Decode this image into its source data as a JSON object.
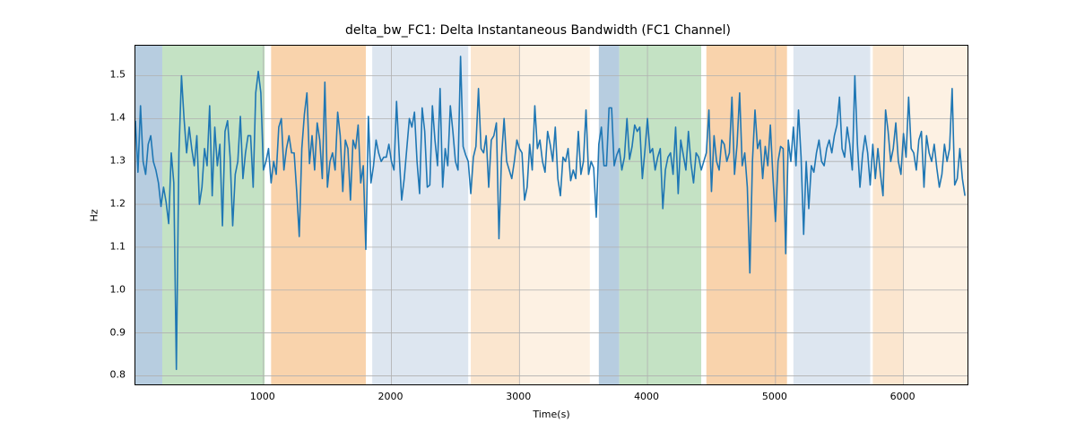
{
  "chart_data": {
    "type": "line",
    "title": "delta_bw_FC1: Delta Instantaneous Bandwidth (FC1 Channel)",
    "xlabel": "Time(s)",
    "ylabel": "Hz",
    "xlim": [
      0,
      6500
    ],
    "ylim": [
      0.78,
      1.57
    ],
    "xticks": [
      1000,
      2000,
      3000,
      4000,
      5000,
      6000
    ],
    "yticks": [
      0.8,
      0.9,
      1.0,
      1.1,
      1.2,
      1.3,
      1.4,
      1.5
    ],
    "bands": [
      {
        "x0": 0,
        "x1": 210,
        "color": "#b7cde0"
      },
      {
        "x0": 210,
        "x1": 1010,
        "color": "#c4e2c4"
      },
      {
        "x0": 1060,
        "x1": 1800,
        "color": "#f9d3ac"
      },
      {
        "x0": 1850,
        "x1": 2600,
        "color": "#dde6f0"
      },
      {
        "x0": 2620,
        "x1": 3000,
        "color": "#fbe6cf"
      },
      {
        "x0": 3000,
        "x1": 3550,
        "color": "#fdf1e3"
      },
      {
        "x0": 3620,
        "x1": 3780,
        "color": "#b7cde0"
      },
      {
        "x0": 3780,
        "x1": 4420,
        "color": "#c4e2c4"
      },
      {
        "x0": 4460,
        "x1": 5090,
        "color": "#f9d3ac"
      },
      {
        "x0": 5140,
        "x1": 5740,
        "color": "#dde6f0"
      },
      {
        "x0": 5760,
        "x1": 6000,
        "color": "#fbe6cf"
      },
      {
        "x0": 6000,
        "x1": 6500,
        "color": "#fdf1e3"
      }
    ],
    "series": [
      {
        "name": "delta_bw_FC1",
        "color": "#1f77b4",
        "x_step": 20,
        "values": [
          1.395,
          1.275,
          1.43,
          1.3,
          1.27,
          1.34,
          1.36,
          1.3,
          1.28,
          1.25,
          1.195,
          1.24,
          1.205,
          1.155,
          1.32,
          1.25,
          0.815,
          1.32,
          1.5,
          1.4,
          1.32,
          1.38,
          1.33,
          1.29,
          1.36,
          1.2,
          1.24,
          1.33,
          1.29,
          1.43,
          1.22,
          1.38,
          1.29,
          1.34,
          1.15,
          1.37,
          1.395,
          1.31,
          1.15,
          1.27,
          1.3,
          1.405,
          1.26,
          1.32,
          1.36,
          1.36,
          1.24,
          1.46,
          1.51,
          1.46,
          1.28,
          1.3,
          1.33,
          1.25,
          1.3,
          1.27,
          1.38,
          1.4,
          1.28,
          1.33,
          1.36,
          1.32,
          1.32,
          1.23,
          1.125,
          1.33,
          1.41,
          1.46,
          1.295,
          1.36,
          1.28,
          1.39,
          1.35,
          1.26,
          1.485,
          1.24,
          1.3,
          1.32,
          1.28,
          1.415,
          1.36,
          1.23,
          1.35,
          1.33,
          1.21,
          1.35,
          1.33,
          1.385,
          1.25,
          1.29,
          1.095,
          1.405,
          1.25,
          1.29,
          1.35,
          1.32,
          1.3,
          1.31,
          1.31,
          1.34,
          1.3,
          1.28,
          1.44,
          1.32,
          1.21,
          1.26,
          1.33,
          1.4,
          1.38,
          1.415,
          1.3,
          1.225,
          1.425,
          1.37,
          1.24,
          1.245,
          1.43,
          1.35,
          1.29,
          1.47,
          1.24,
          1.33,
          1.29,
          1.43,
          1.37,
          1.3,
          1.28,
          1.545,
          1.335,
          1.315,
          1.3,
          1.225,
          1.31,
          1.335,
          1.47,
          1.33,
          1.32,
          1.36,
          1.24,
          1.35,
          1.36,
          1.39,
          1.12,
          1.31,
          1.4,
          1.3,
          1.28,
          1.26,
          1.3,
          1.35,
          1.33,
          1.32,
          1.21,
          1.24,
          1.34,
          1.28,
          1.43,
          1.33,
          1.35,
          1.3,
          1.275,
          1.37,
          1.34,
          1.3,
          1.38,
          1.26,
          1.22,
          1.31,
          1.3,
          1.33,
          1.255,
          1.28,
          1.26,
          1.37,
          1.27,
          1.3,
          1.42,
          1.27,
          1.3,
          1.285,
          1.17,
          1.34,
          1.38,
          1.29,
          1.29,
          1.425,
          1.425,
          1.29,
          1.315,
          1.33,
          1.28,
          1.31,
          1.4,
          1.305,
          1.335,
          1.385,
          1.37,
          1.38,
          1.26,
          1.325,
          1.4,
          1.32,
          1.33,
          1.28,
          1.31,
          1.33,
          1.19,
          1.28,
          1.31,
          1.32,
          1.27,
          1.38,
          1.225,
          1.35,
          1.315,
          1.28,
          1.37,
          1.295,
          1.25,
          1.32,
          1.31,
          1.28,
          1.3,
          1.32,
          1.42,
          1.23,
          1.36,
          1.3,
          1.28,
          1.35,
          1.34,
          1.3,
          1.32,
          1.45,
          1.27,
          1.34,
          1.46,
          1.29,
          1.32,
          1.24,
          1.04,
          1.3,
          1.42,
          1.33,
          1.35,
          1.26,
          1.335,
          1.29,
          1.385,
          1.265,
          1.16,
          1.3,
          1.335,
          1.33,
          1.085,
          1.35,
          1.3,
          1.38,
          1.29,
          1.42,
          1.31,
          1.13,
          1.3,
          1.19,
          1.29,
          1.275,
          1.32,
          1.35,
          1.3,
          1.29,
          1.33,
          1.35,
          1.32,
          1.36,
          1.385,
          1.45,
          1.33,
          1.31,
          1.38,
          1.34,
          1.28,
          1.5,
          1.34,
          1.24,
          1.315,
          1.36,
          1.32,
          1.245,
          1.34,
          1.26,
          1.33,
          1.27,
          1.22,
          1.42,
          1.37,
          1.3,
          1.33,
          1.39,
          1.3,
          1.27,
          1.365,
          1.31,
          1.45,
          1.33,
          1.32,
          1.28,
          1.35,
          1.37,
          1.24,
          1.36,
          1.32,
          1.3,
          1.34,
          1.285,
          1.24,
          1.27,
          1.34,
          1.3,
          1.33,
          1.47,
          1.245,
          1.26,
          1.33,
          1.26,
          1.22
        ]
      }
    ]
  }
}
